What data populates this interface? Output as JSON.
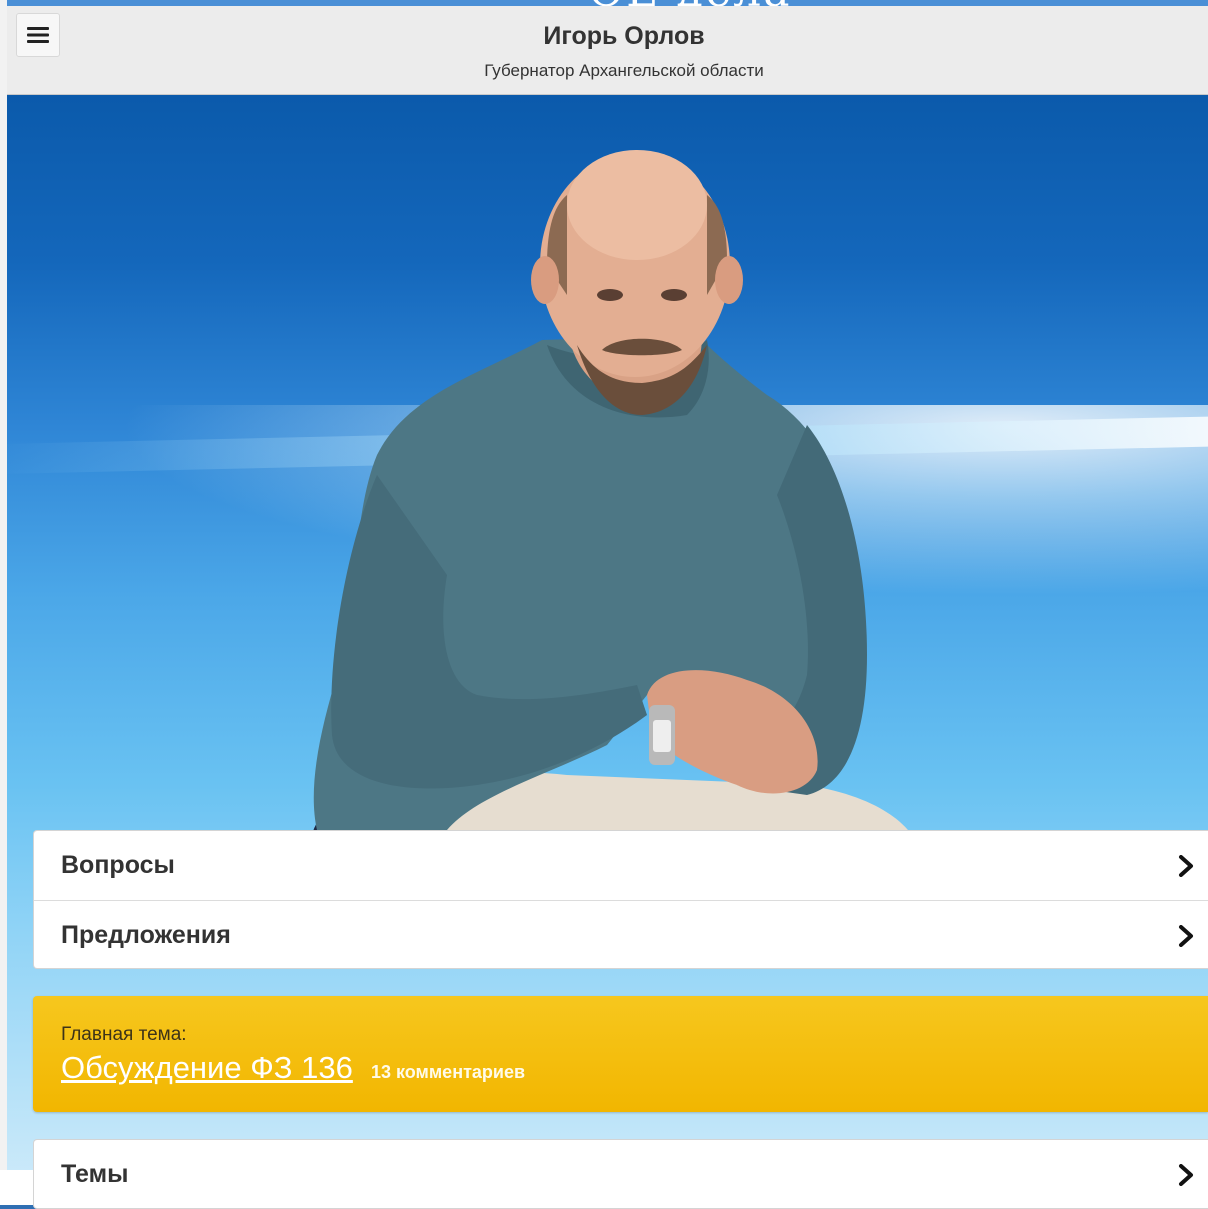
{
  "header": {
    "cropped_title": "ОЕ дела",
    "title": "Игорь Орлов",
    "subtitle": "Губернатор Архангельской области",
    "menu_icon": "hamburger-menu-icon"
  },
  "hero": {
    "image": "portrait-photo"
  },
  "menu": {
    "items": [
      {
        "label": "Вопросы",
        "icon": "chevron-right-icon"
      },
      {
        "label": "Предложения",
        "icon": "chevron-right-icon"
      }
    ]
  },
  "main_topic": {
    "label": "Главная тема:",
    "link": "Обсуждение ФЗ 136",
    "comments": "13 комментариев"
  },
  "themes": {
    "label": "Темы",
    "icon": "chevron-right-icon"
  },
  "colors": {
    "header_bg": "#ececec",
    "hero_top": "#0b5aab",
    "topic_yellow": "#f2b600"
  }
}
